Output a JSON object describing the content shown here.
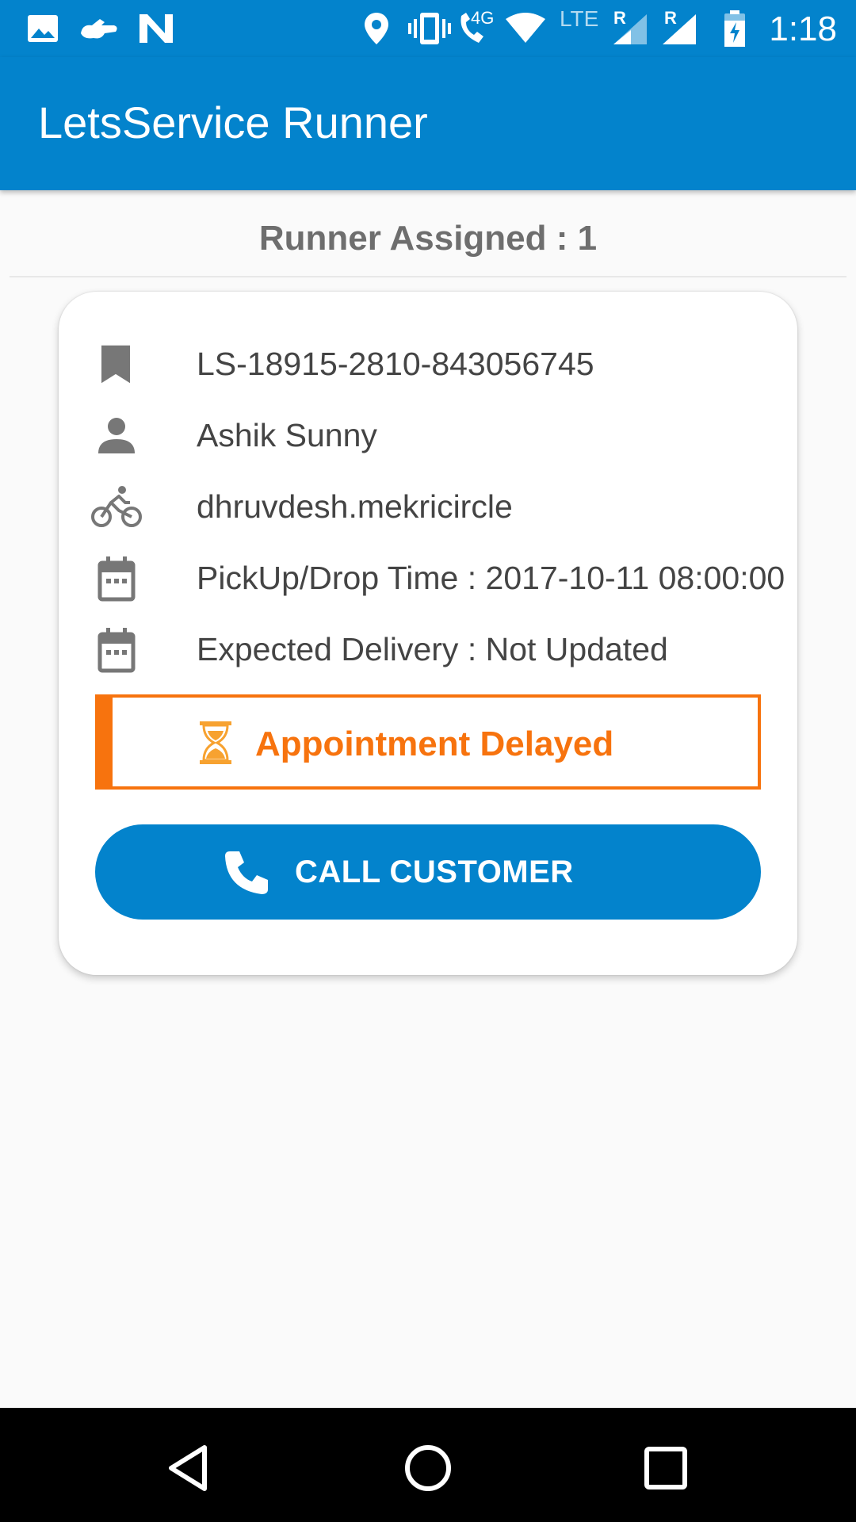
{
  "status_bar": {
    "time": "1:18",
    "network_label": "4G",
    "lte_label": "LTE",
    "roaming_label_1": "R",
    "roaming_label_2": "R",
    "icons": [
      "image-icon",
      "app-notification-icon",
      "n-logo-icon",
      "location-icon",
      "vibrate-icon",
      "wifi-call-icon",
      "wifi-icon",
      "lte-signal-icon",
      "signal-icon",
      "battery-charging-icon"
    ]
  },
  "app_bar": {
    "title": "LetsService Runner"
  },
  "runner_header": {
    "text": "Runner Assigned : 1"
  },
  "card": {
    "booking_id": "LS-18915-2810-843056745",
    "customer_name": "Ashik Sunny",
    "runner_id": "dhruvdesh.mekricircle",
    "pickup_drop_time": "PickUp/Drop Time : 2017-10-11 08:00:00",
    "expected_delivery": "Expected Delivery : Not Updated",
    "status_text": "Appointment Delayed",
    "call_button_label": "CALL CUSTOMER"
  },
  "colors": {
    "primary": "#0383cc",
    "warning": "#f7730e",
    "text": "#444444",
    "icon": "#777777"
  },
  "nav_bar": {
    "buttons": [
      "back-icon",
      "home-icon",
      "recents-icon"
    ]
  }
}
